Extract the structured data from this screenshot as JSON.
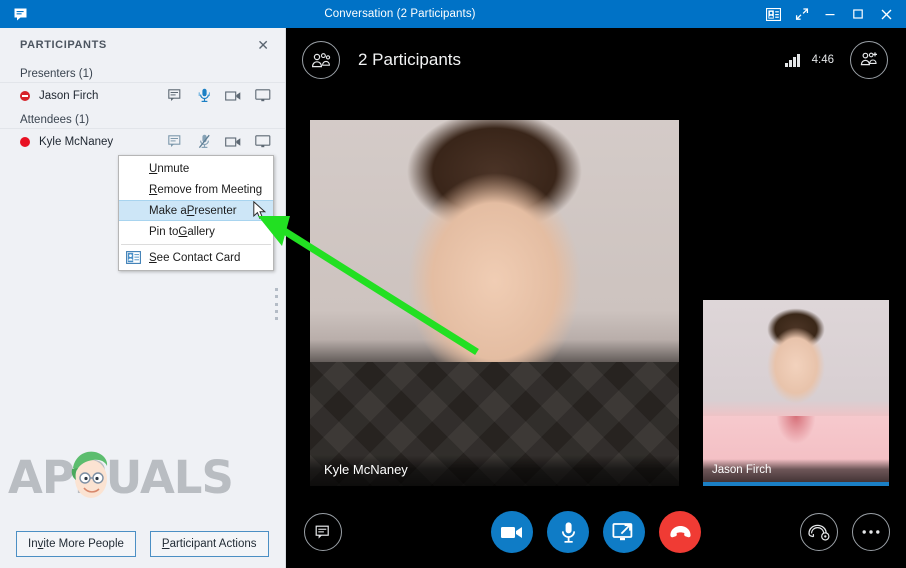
{
  "window": {
    "title": "Conversation (2 Participants)",
    "left_icon": "im-conversation-icon",
    "buttons": [
      {
        "name": "dock-contact-card-icon",
        "label": ""
      },
      {
        "name": "full-screen-icon",
        "label": ""
      },
      {
        "name": "minimize-icon",
        "label": ""
      },
      {
        "name": "maximize-icon",
        "label": ""
      },
      {
        "name": "close-icon",
        "label": ""
      }
    ]
  },
  "sidebar": {
    "header_title": "PARTICIPANTS",
    "close_label": "✕",
    "groups": [
      {
        "label": "Presenters (1)",
        "people": [
          {
            "name": "Jason Firch",
            "presence": "busy",
            "actions": [
              "im-icon",
              "mic-on-icon",
              "video-icon",
              "share-screen-icon"
            ]
          }
        ]
      },
      {
        "label": "Attendees (1)",
        "people": [
          {
            "name": "Kyle McNaney",
            "presence": "dnd",
            "actions": [
              "im-icon",
              "mic-muted-icon",
              "video-icon",
              "share-screen-icon"
            ]
          }
        ]
      }
    ],
    "watermark": "APPUALS",
    "footer": {
      "invite_pre": "In",
      "invite_mnemonic": "v",
      "invite_post": "ite More People",
      "actions_mnemonic": "P",
      "actions_post": "articipant Actions"
    }
  },
  "context_menu": {
    "items": [
      {
        "pre": "",
        "mnemonic": "U",
        "post": "nmute",
        "selected": false,
        "icon": ""
      },
      {
        "pre": "",
        "mnemonic": "R",
        "post": "emove from Meeting",
        "selected": false,
        "icon": ""
      },
      {
        "pre": "Make a ",
        "mnemonic": "P",
        "post": "resenter",
        "selected": true,
        "icon": ""
      },
      {
        "pre": "Pin to ",
        "mnemonic": "G",
        "post": "allery",
        "selected": false,
        "icon": ""
      },
      {
        "pre": "",
        "mnemonic": "S",
        "post": "ee Contact Card",
        "selected": false,
        "icon": "contact-card-icon"
      }
    ]
  },
  "stage": {
    "title": "2 Participants",
    "roster_icon": "participants-icon",
    "add_participants_icon": "add-participants-icon",
    "call_timer": "4:46",
    "signal_icon": "signal-strength-icon",
    "signal_bars": 4,
    "main_video_label": "Kyle McNaney",
    "thumb_video_label": "Jason Firch",
    "callbar": {
      "im_icon": "im-icon",
      "video_icon": "video-camera-icon",
      "mic_icon": "microphone-icon",
      "present_icon": "present-screen-icon",
      "hangup_icon": "end-call-icon",
      "devices_icon": "call-devices-icon",
      "more_icon": "more-options-icon"
    }
  },
  "colors": {
    "titlebar": "#0072c6",
    "accent": "#0f7cc6",
    "hangup": "#f03b34",
    "sidebar_bg": "#eff1f5",
    "presence_busy": "#d6232a",
    "presence_dnd": "#e81123",
    "menu_highlight": "#cde6f7",
    "annotation_arrow": "#22e022"
  }
}
